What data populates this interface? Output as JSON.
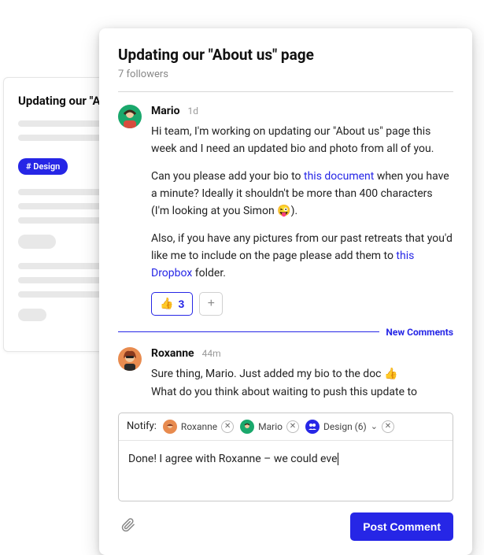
{
  "bg_card": {
    "title": "Updating our \"A",
    "tag": "# Design"
  },
  "thread": {
    "title": "Updating our \"About us\" page",
    "followers": "7 followers",
    "new_comments_label": "New Comments"
  },
  "comments": [
    {
      "author": "Mario",
      "time": "1d",
      "p1a": "Hi team, I'm working on updating our \"About us\" page this week and I need an updated bio and photo from all of you.",
      "p2a": "Can you please add your bio to ",
      "p2link": "this document",
      "p2b": " when you have a minute? Ideally it shouldn't be more than 400 characters (I'm looking at you Simon ",
      "p2emoji": "😜",
      "p2c": ").",
      "p3a": "Also, if you have any pictures from our past retreats that you'd like me to include on the page please add them to ",
      "p3link": "this Dropbox",
      "p3b": " folder.",
      "reaction_emoji": "👍",
      "reaction_count": "3",
      "add_label": "+"
    },
    {
      "author": "Roxanne",
      "time": "44m",
      "p1a": "Sure thing, Mario. Just added my bio to the doc ",
      "p1emoji": "👍",
      "p2a": "What do you think about waiting to push this update to"
    }
  ],
  "compose": {
    "notify_label": "Notify:",
    "chips": [
      {
        "name": "Roxanne"
      },
      {
        "name": "Mario"
      },
      {
        "name": "Design (6)"
      }
    ],
    "text": "Done! I agree with Roxanne – we could eve",
    "post_label": "Post Comment"
  }
}
